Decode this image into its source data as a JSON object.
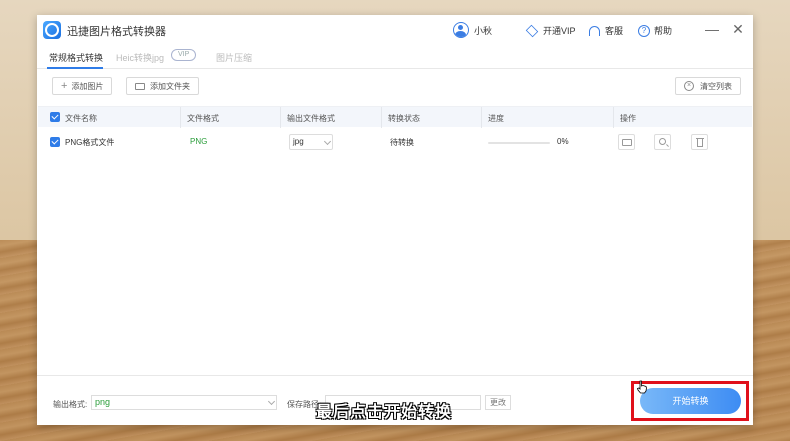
{
  "app": {
    "title": "迅捷图片格式转换器"
  },
  "topbar": {
    "user_name": "小秋",
    "vip_label": "开通VIP",
    "service_label": "客服",
    "help_label": "帮助",
    "minimize_symbol": "—",
    "close_symbol": "✕"
  },
  "tabs": [
    {
      "label": "常规格式转换",
      "active": true
    },
    {
      "label": "Heic转换jpg",
      "active": false,
      "badge": "VIP"
    },
    {
      "label": "图片压缩",
      "active": false
    }
  ],
  "toolbar": {
    "add_image": "添加图片",
    "add_folder": "添加文件夹",
    "clear_list": "清空列表"
  },
  "table": {
    "columns": [
      "文件名称",
      "文件格式",
      "输出文件格式",
      "转换状态",
      "进度",
      "操作"
    ],
    "rows": [
      {
        "name": "PNG格式文件",
        "format": "PNG",
        "output": "jpg",
        "status": "待转换",
        "progress_text": "0%",
        "progress": 0
      }
    ]
  },
  "footer": {
    "output_format_label": "输出格式:",
    "output_format_value": "png",
    "save_path_label": "保存路径:",
    "change_label": "更改",
    "start_label": "开始转换"
  },
  "caption": "最后点击开始转换",
  "colors": {
    "accent": "#2f7ce8",
    "highlight": "#e0101a",
    "format_green": "#2a9d3a"
  }
}
